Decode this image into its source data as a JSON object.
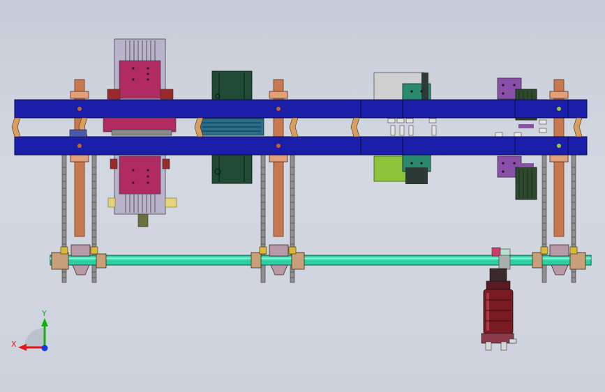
{
  "triad": {
    "x_label": "X",
    "y_label": "Y",
    "x_color": "#e01818",
    "y_color": "#10b010",
    "z_color": "#1838e0"
  },
  "model": {
    "beam_color": "#1b1ea8",
    "screw_rod_color": "#c8784f",
    "shaft_color": "#2fcfa2",
    "cylinder_color": "#b02858",
    "motor_color": "#7a1b24",
    "block_dark_color": "#1f4a33",
    "block_teal_color": "#2a8a6e",
    "block_lime_color": "#8bc33a"
  }
}
